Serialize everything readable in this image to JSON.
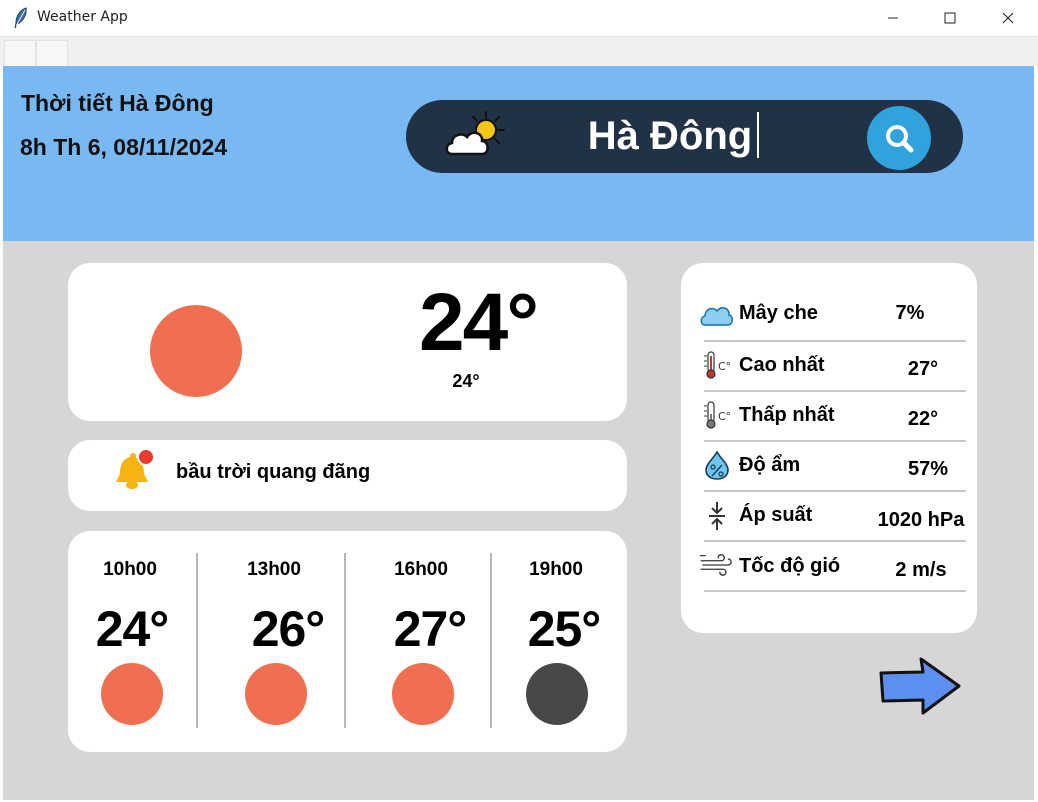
{
  "window": {
    "title": "Weather App",
    "minimize_icon": "minimize-icon",
    "maximize_icon": "maximize-icon",
    "close_icon": "close-icon"
  },
  "header": {
    "location_title": "Thời tiết Hà Đông",
    "datetime": "8h Th 6, 08/11/2024",
    "background_color": "#78b9f4"
  },
  "search": {
    "value": "Hà Đông",
    "weather_icon": "partly-cloudy-icon",
    "button_icon": "search-icon",
    "bar_color": "#223246",
    "button_color": "#30a3dc"
  },
  "current": {
    "temp": "24°",
    "feels_like": "24°",
    "condition_icon": "sun-icon",
    "icon_color": "#ef6f50"
  },
  "alert": {
    "icon": "bell-icon",
    "description": "bầu trời quang đãng"
  },
  "hourly": [
    {
      "time": "10h00",
      "temp": "24°",
      "icon": "sun-icon",
      "color": "#ef6f50"
    },
    {
      "time": "13h00",
      "temp": "26°",
      "icon": "sun-icon",
      "color": "#ef6f50"
    },
    {
      "time": "16h00",
      "temp": "27°",
      "icon": "sun-icon",
      "color": "#ef6f50"
    },
    {
      "time": "19h00",
      "temp": "25°",
      "icon": "moon-icon",
      "color": "#48484a"
    }
  ],
  "details": [
    {
      "icon": "cloud-icon",
      "label": "Mây che",
      "value": "7%"
    },
    {
      "icon": "thermometer-high-icon",
      "label": "Cao nhất",
      "value": "27°"
    },
    {
      "icon": "thermometer-low-icon",
      "label": "Thấp nhất",
      "value": "22°"
    },
    {
      "icon": "humidity-icon",
      "label": "Độ ẩm",
      "value": "57%"
    },
    {
      "icon": "pressure-icon",
      "label": "Áp suất",
      "value": "1020 hPa"
    },
    {
      "icon": "wind-icon",
      "label": "Tốc độ gió",
      "value": "2 m/s"
    }
  ],
  "navigation": {
    "next_icon": "arrow-right-icon"
  }
}
